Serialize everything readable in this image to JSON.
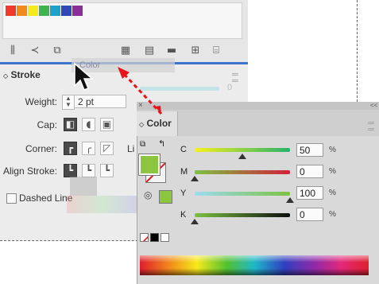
{
  "swatches": [
    "#ee3a2b",
    "#f08a1a",
    "#f6ea1c",
    "#3fb34f",
    "#1fa1c9",
    "#2f49b6",
    "#8a2e9a"
  ],
  "swatch_toolbar": {
    "icons": [
      "swatch-libraries-icon",
      "show-kinds-icon",
      "swatch-options-icon",
      "color-group-icon",
      "edit-group-icon",
      "new-group-folder-icon",
      "new-swatch-icon",
      "delete-swatch-icon"
    ]
  },
  "stroke": {
    "tab_label": "Stroke",
    "weight_label": "Weight:",
    "weight_value": "2 pt",
    "cap_label": "Cap:",
    "corner_label": "Corner:",
    "corner_limit_label": "Li",
    "align_label": "Align Stroke:",
    "dashed_label": "Dashed Line",
    "ghost_tab_label": "Color",
    "ghost_value": "0"
  },
  "color": {
    "tab_label": "Color",
    "collapse_glyph": "<<",
    "close_glyph": "×",
    "fill_color": "#8cc63f",
    "colors": {
      "cyan": "#00aeef",
      "magenta": "#ec008c",
      "yellow": "#fff200",
      "black": "#000000"
    },
    "sliders": [
      {
        "label": "C",
        "value": "50",
        "unit": "%",
        "level": 50
      },
      {
        "label": "M",
        "value": "0",
        "unit": "%",
        "level": 0
      },
      {
        "label": "Y",
        "value": "100",
        "unit": "%",
        "level": 100
      },
      {
        "label": "K",
        "value": "0",
        "unit": "%",
        "level": 0
      }
    ]
  },
  "accent": {
    "panel_blue": "#3b74c9",
    "arrow_red": "#e8141b"
  }
}
